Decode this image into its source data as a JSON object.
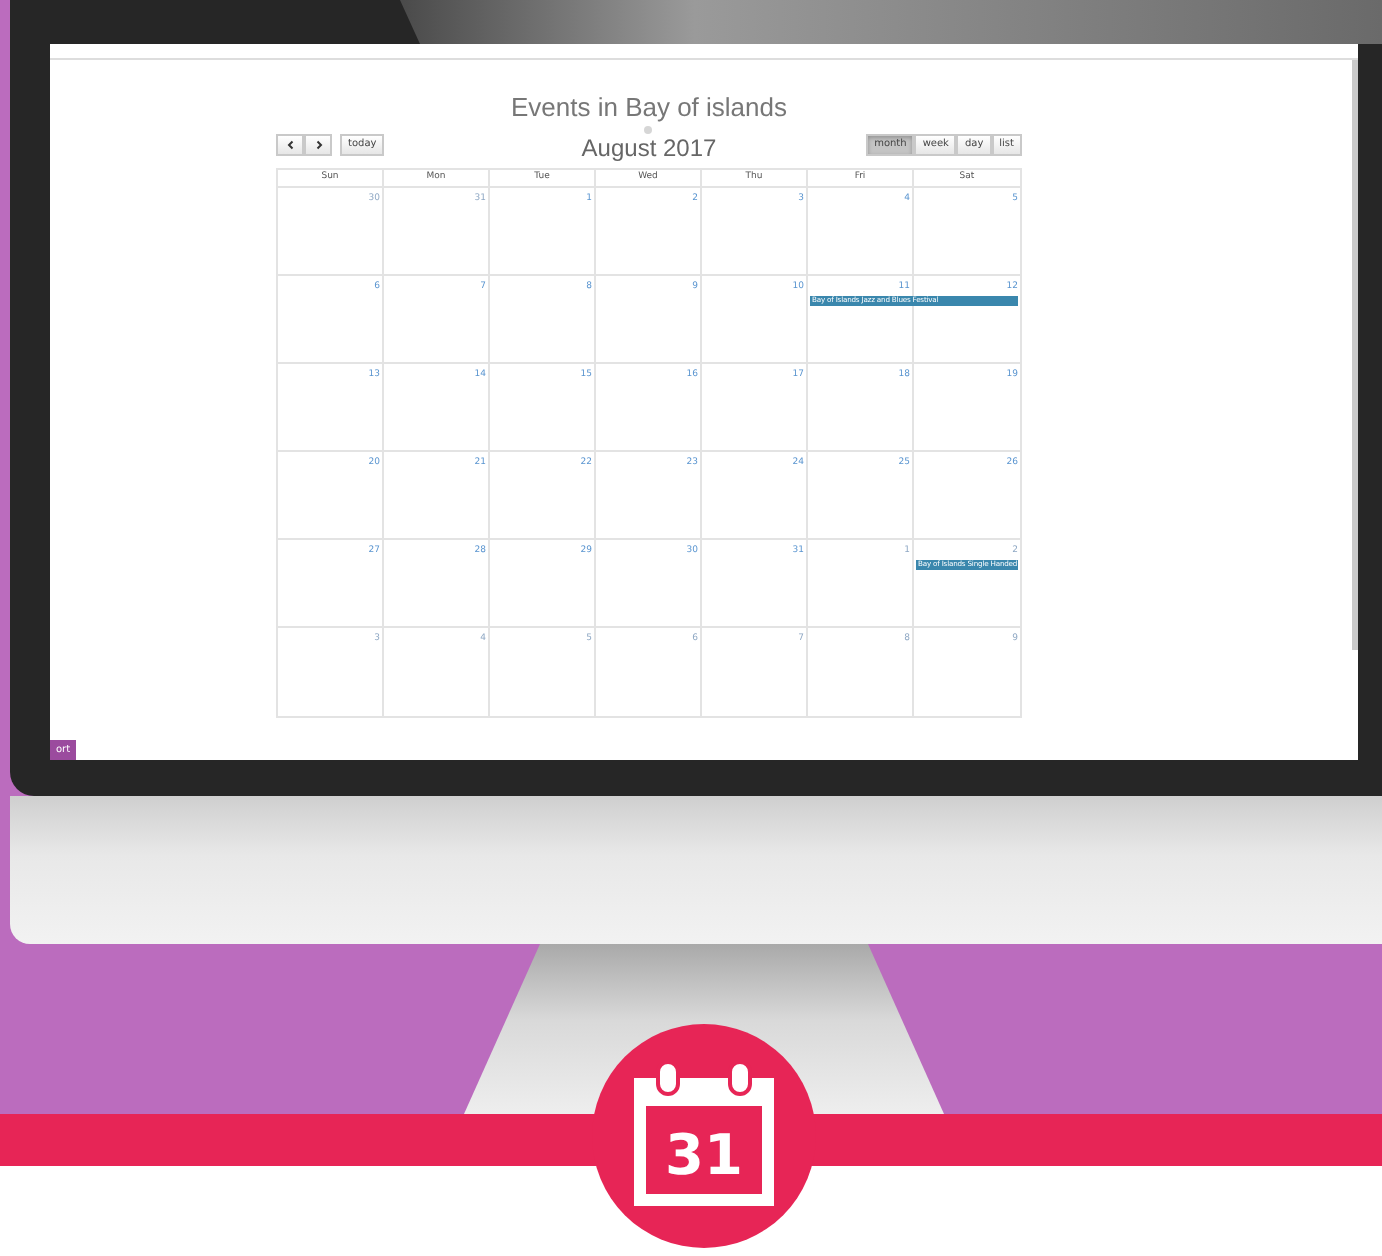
{
  "calendar": {
    "title": "Events in Bay of islands",
    "today_button": "today",
    "period": "August 2017",
    "views": [
      {
        "label": "month",
        "selected": true
      },
      {
        "label": "week",
        "selected": false
      },
      {
        "label": "day",
        "selected": false
      },
      {
        "label": "list",
        "selected": false
      }
    ],
    "weekdays": [
      "Sun",
      "Mon",
      "Tue",
      "Wed",
      "Thu",
      "Fri",
      "Sat"
    ],
    "weeks": [
      {
        "days": [
          {
            "number": "30",
            "other_month": true
          },
          {
            "number": "31",
            "other_month": true
          },
          {
            "number": "1",
            "other_month": false
          },
          {
            "number": "2",
            "other_month": false
          },
          {
            "number": "3",
            "other_month": false
          },
          {
            "number": "4",
            "other_month": false
          },
          {
            "number": "5",
            "other_month": false
          }
        ]
      },
      {
        "days": [
          {
            "number": "6",
            "other_month": false
          },
          {
            "number": "7",
            "other_month": false
          },
          {
            "number": "8",
            "other_month": false
          },
          {
            "number": "9",
            "other_month": false
          },
          {
            "number": "10",
            "other_month": false
          },
          {
            "number": "11",
            "other_month": false,
            "events": [
              {
                "title": "Bay of Islands Jazz and Blues Festival",
                "multi_day": true
              }
            ]
          },
          {
            "number": "12",
            "other_month": false
          }
        ]
      },
      {
        "days": [
          {
            "number": "13",
            "other_month": false
          },
          {
            "number": "14",
            "other_month": false
          },
          {
            "number": "15",
            "other_month": false
          },
          {
            "number": "16",
            "other_month": false
          },
          {
            "number": "17",
            "other_month": false
          },
          {
            "number": "18",
            "other_month": false
          },
          {
            "number": "19",
            "other_month": false
          }
        ]
      },
      {
        "days": [
          {
            "number": "20",
            "other_month": false
          },
          {
            "number": "21",
            "other_month": false
          },
          {
            "number": "22",
            "other_month": false
          },
          {
            "number": "23",
            "other_month": false
          },
          {
            "number": "24",
            "other_month": false
          },
          {
            "number": "25",
            "other_month": false
          },
          {
            "number": "26",
            "other_month": false
          }
        ]
      },
      {
        "days": [
          {
            "number": "27",
            "other_month": false
          },
          {
            "number": "28",
            "other_month": false
          },
          {
            "number": "29",
            "other_month": false
          },
          {
            "number": "30",
            "other_month": false
          },
          {
            "number": "31",
            "other_month": false
          },
          {
            "number": "1",
            "other_month": true
          },
          {
            "number": "2",
            "other_month": true,
            "events": [
              {
                "title": "Bay of Islands Single Handed"
              }
            ]
          }
        ]
      },
      {
        "days": [
          {
            "number": "3",
            "other_month": true
          },
          {
            "number": "4",
            "other_month": true
          },
          {
            "number": "5",
            "other_month": true
          },
          {
            "number": "6",
            "other_month": true
          },
          {
            "number": "7",
            "other_month": true
          },
          {
            "number": "8",
            "other_month": true
          },
          {
            "number": "9",
            "other_month": true
          }
        ]
      }
    ]
  },
  "export_button": "ort",
  "badge": {
    "day": "31"
  }
}
